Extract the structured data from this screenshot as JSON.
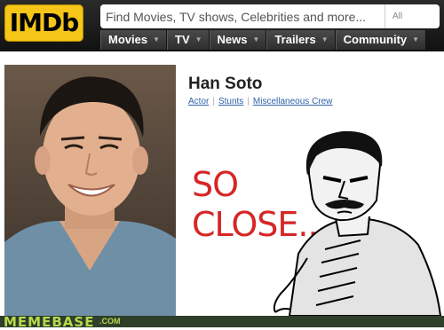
{
  "header": {
    "logo_text": "IMDb",
    "search": {
      "placeholder": "Find Movies, TV shows, Celebrities and more...",
      "category": "All"
    },
    "nav": [
      {
        "label": "Movies"
      },
      {
        "label": "TV"
      },
      {
        "label": "News"
      },
      {
        "label": "Trailers"
      },
      {
        "label": "Community"
      }
    ]
  },
  "profile": {
    "name": "Han Soto",
    "roles": [
      "Actor",
      "Stunts",
      "Miscellaneous Crew"
    ]
  },
  "meme": {
    "line1": "SO",
    "line2": "CLOSE..."
  },
  "footer": {
    "brand": "MEMEBASE",
    "tld": ".COM"
  },
  "colors": {
    "imdb_yellow": "#f5c518",
    "header_dark": "#1a1a1a",
    "link_blue": "#2f62a8",
    "meme_red": "#d62626",
    "footer_green": "#b8d84c"
  }
}
